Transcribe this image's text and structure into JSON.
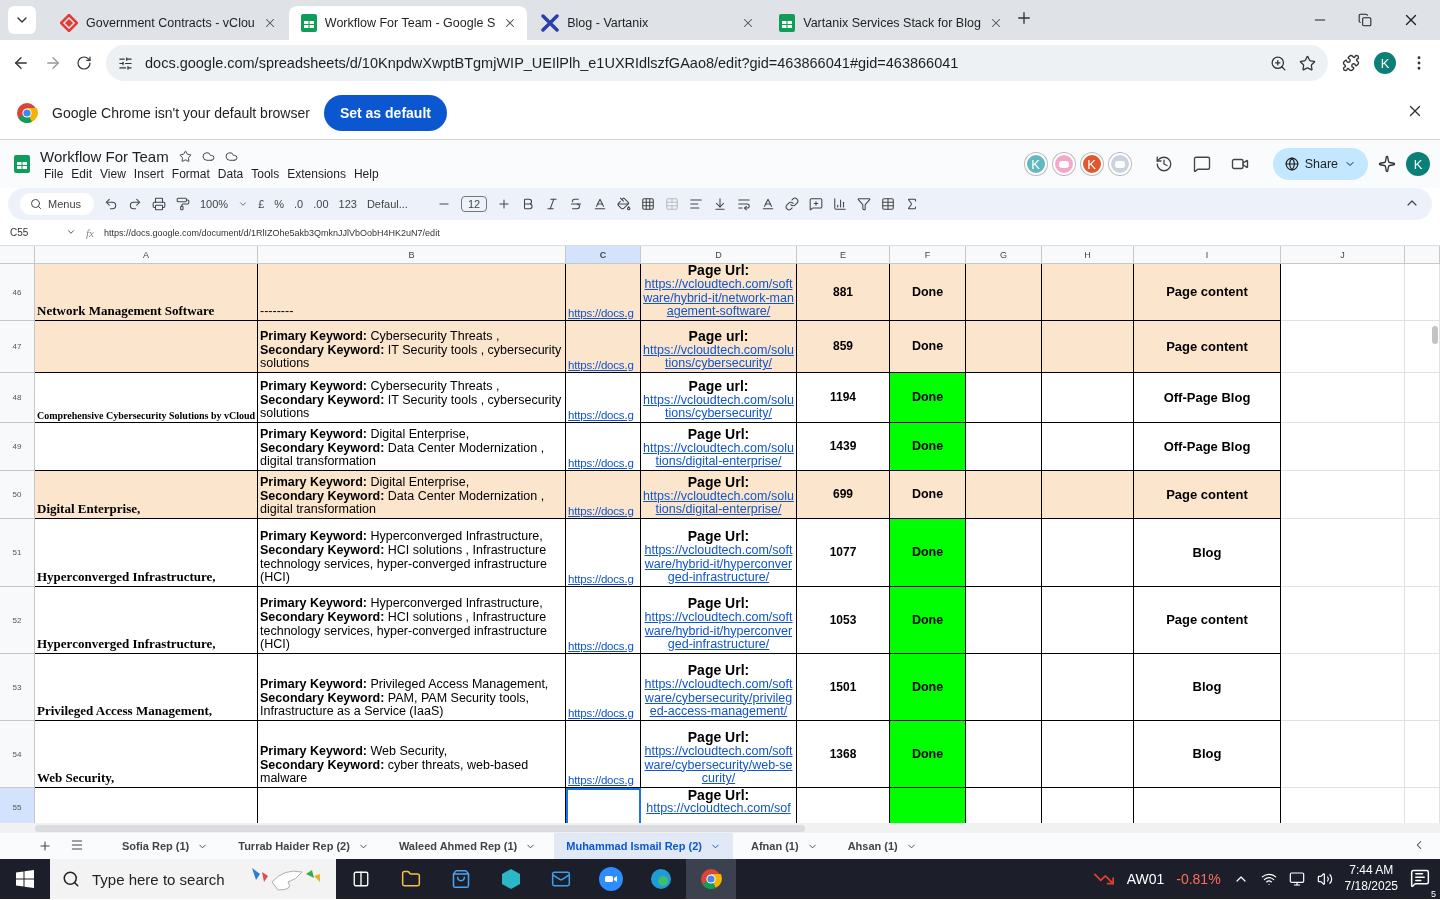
{
  "browser": {
    "tabs": [
      {
        "title": "Government Contracts - vClou",
        "kind": "vcloud",
        "selected": false
      },
      {
        "title": "Workflow For Team - Google S",
        "kind": "sheets",
        "selected": true
      },
      {
        "title": "Blog - Vartanix",
        "kind": "vartanix",
        "selected": false
      },
      {
        "title": "Vartanix Services Stack for Blog",
        "kind": "sheets",
        "selected": false
      }
    ],
    "url": "docs.google.com/spreadsheets/d/10KnpdwXwptBTgmjWIP_UEIlPlh_e1UXRIdlszfGAao8/edit?gid=463866041#gid=463866041",
    "profile": "K"
  },
  "infobar": {
    "message": "Google Chrome isn't your default browser",
    "button": "Set as default"
  },
  "document": {
    "title": "Workflow For Team",
    "menus": [
      "File",
      "Edit",
      "View",
      "Insert",
      "Format",
      "Data",
      "Tools",
      "Extensions",
      "Help"
    ],
    "collaborators": [
      {
        "kind": "letter",
        "text": "K",
        "color": "#63b8bd"
      },
      {
        "kind": "icon",
        "color": "#f4a7c9"
      },
      {
        "kind": "letter",
        "text": "K",
        "color": "#e4572e"
      },
      {
        "kind": "icon",
        "color": "#c9d3e0"
      }
    ],
    "share": "Share",
    "account": "K"
  },
  "toolbar": {
    "menus": "Menus",
    "zoom": "100%",
    "currency": "£",
    "percent": "%",
    "decrease_decimals": ".0",
    "increase_decimals": ".00",
    "number_format": "123",
    "font": "Defaul...",
    "font_size": "12"
  },
  "formula_bar": {
    "cell": "C55",
    "fx": "fx",
    "value": "https://docs.google.com/document/d/1RlIZOhe5akb3QmknJJlVbOobH4HK2uN7/edit"
  },
  "columns": [
    {
      "label": "A",
      "selected": false
    },
    {
      "label": "B",
      "selected": false
    },
    {
      "label": "C",
      "selected": true
    },
    {
      "label": "D",
      "selected": false
    },
    {
      "label": "E",
      "selected": false
    },
    {
      "label": "F",
      "selected": false
    },
    {
      "label": "G",
      "selected": false
    },
    {
      "label": "H",
      "selected": false
    },
    {
      "label": "I",
      "selected": false
    },
    {
      "label": "J",
      "selected": false
    }
  ],
  "rows": [
    {
      "number": "46",
      "selected": false,
      "color": "#fce5cd",
      "a": "Network Management Software",
      "b": [
        "--------"
      ],
      "c": "https://docs.g",
      "d": {
        "label": "Page Url:",
        "url": "https://vcloudtech.com/software/hybrid-it/network-management-software/"
      },
      "e": "881",
      "f": {
        "text": "Done",
        "highlight": false
      },
      "i": "Page content"
    },
    {
      "number": "47",
      "selected": false,
      "color": "#fce5cd",
      "b": [
        "**Primary Keyword:** Cybersecurity Threats ,",
        "**Secondary Keyword:**  IT Security tools , cybersecurity solutions"
      ],
      "c": "https://docs.g",
      "d": {
        "label": "Page url:",
        "url": "https://vcloudtech.com/solutions/cybersecurity/"
      },
      "e": "859",
      "f": {
        "text": "Done",
        "highlight": false
      },
      "i": "Page content"
    },
    {
      "number": "48",
      "selected": false,
      "color": "#ffffff",
      "a": "Comprehensive Cybersecurity Solutions by vCloud",
      "b": [
        "**Primary Keyword:** Cybersecurity Threats ,",
        "**Secondary Keyword:**  IT Security tools , cybersecurity solutions"
      ],
      "c": "https://docs.g",
      "d": {
        "label": "Page url:",
        "url": "https://vcloudtech.com/solutions/cybersecurity/"
      },
      "e": "1194",
      "f": {
        "text": "Done",
        "highlight": true
      },
      "i": "Off-Page Blog"
    },
    {
      "number": "49",
      "selected": false,
      "color": "#ffffff",
      "b": [
        "**Primary Keyword:** Digital Enterprise,",
        "**Secondary Keyword:** Data Center Modernization , digital transformation"
      ],
      "c": "https://docs.g",
      "d": {
        "label": "Page Url:",
        "url": "https://vcloudtech.com/solutions/digital-enterprise/"
      },
      "e": "1439",
      "f": {
        "text": "Done",
        "highlight": true
      },
      "i": "Off-Page Blog"
    },
    {
      "number": "50",
      "selected": false,
      "color": "#fce5cd",
      "a": "Digital Enterprise,",
      "b": [
        "**Primary Keyword:** Digital Enterprise,",
        "**Secondary Keyword:** Data Center Modernization , digital transformation"
      ],
      "c": "https://docs.g",
      "d": {
        "label": "Page Url:",
        "url": "https://vcloudtech.com/solutions/digital-enterprise/"
      },
      "e": "699",
      "f": {
        "text": "Done",
        "highlight": false
      },
      "i": "Page content"
    },
    {
      "number": "51",
      "selected": false,
      "color": "#ffffff",
      "a": "Hyperconverged Infrastructure,",
      "b": [
        "**Primary Keyword:** Hyperconverged Infrastructure,",
        "**Secondary Keyword:** HCI solutions , Infrastructure technology services, hyper-converged infrastructure (HCI)"
      ],
      "c": "https://docs.g",
      "d": {
        "label": "Page Url:",
        "url": "https://vcloudtech.com/software/hybrid-it/hyperconverged-infrastructure/"
      },
      "e": "1077",
      "f": {
        "text": "Done",
        "highlight": true
      },
      "i": "Blog"
    },
    {
      "number": "52",
      "selected": false,
      "color": "#ffffff",
      "a": "Hyperconverged Infrastructure,",
      "b": [
        "**Primary Keyword:** Hyperconverged Infrastructure,",
        "**Secondary Keyword:** HCI solutions , Infrastructure technology services, hyper-converged infrastructure (HCI)"
      ],
      "c": "https://docs.g",
      "d": {
        "label": "Page Url:",
        "url": "https://vcloudtech.com/software/hybrid-it/hyperconverged-infrastructure/"
      },
      "e": "1053",
      "f": {
        "text": "Done",
        "highlight": true
      },
      "i": "Page content"
    },
    {
      "number": "53",
      "selected": false,
      "color": "#ffffff",
      "a": "Privileged Access Management,",
      "b": [
        "**Primary Keyword:** Privileged Access Management,",
        "**Secondary Keyword:** PAM, PAM Security tools, Infrastructure as a Service (IaaS)"
      ],
      "c": "https://docs.g",
      "d": {
        "label": "Page Url:",
        "url": "https://vcloudtech.com/software/cybersecurity/privileged-access-management/"
      },
      "e": "1501",
      "f": {
        "text": "Done",
        "highlight": true
      },
      "i": "Blog"
    },
    {
      "number": "54",
      "selected": false,
      "color": "#ffffff",
      "a": "Web Security,",
      "b": [
        "**Primary Keyword:** Web Security,",
        "**Secondary Keyword:** cyber threats, web-based malware"
      ],
      "c": "https://docs.g",
      "d": {
        "label": "Page Url:",
        "url": "https://vcloudtech.com/software/cybersecurity/web-security/"
      },
      "e": "1368",
      "f": {
        "text": "Done",
        "highlight": true
      },
      "i": "Blog"
    },
    {
      "number": "55",
      "selected": true,
      "color": "#ffffff",
      "d": {
        "label": "Page Url:",
        "url": "https://vcloudtech.com/sof"
      },
      "f": {
        "highlight": true
      }
    }
  ],
  "sheets": [
    {
      "name": "Sofia Rep (1)",
      "selected": false
    },
    {
      "name": "Turrab Haider Rep (2)",
      "selected": false
    },
    {
      "name": "Waleed Ahmed Rep (1)",
      "selected": false
    },
    {
      "name": "Muhammad Ismail Rep (2)",
      "selected": true
    },
    {
      "name": "Afnan (1)",
      "selected": false
    },
    {
      "name": "Ahsan (1)",
      "selected": false
    }
  ],
  "taskbar": {
    "search": {
      "placeholder": "Type here to search"
    },
    "stock": {
      "symbol": "AW01",
      "change": "-0.81%"
    },
    "time": "7:44 AM",
    "date": "7/18/2025",
    "notifications": "5"
  }
}
